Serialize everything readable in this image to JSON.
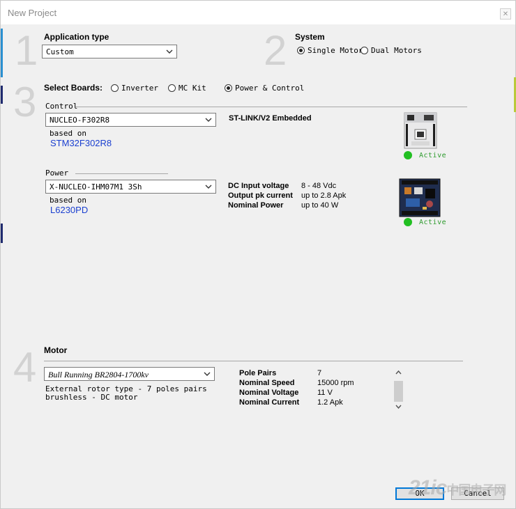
{
  "window": {
    "title": "New Project",
    "close_icon": "close-icon"
  },
  "sections": {
    "n1": "1",
    "n2": "2",
    "n3": "3",
    "n4": "4"
  },
  "application_type": {
    "label": "Application type",
    "value": "Custom"
  },
  "system": {
    "label": "System",
    "options": [
      "Single Motor",
      "Dual Motors"
    ],
    "selected": "Single Motor"
  },
  "boards": {
    "label": "Select Boards:",
    "options": [
      "Inverter",
      "MC Kit",
      "Power & Control"
    ],
    "selected": "Power & Control",
    "control": {
      "label": "Control",
      "value": "NUCLEO-F302R8",
      "based_on_label": "based on",
      "mcu": "STM32F302R8",
      "feature": "ST-LINK/V2 Embedded",
      "status": "Active"
    },
    "power": {
      "label": "Power",
      "value": "X-NUCLEO-IHM07M1 3Sh",
      "based_on_label": "based on",
      "driver": "L6230PD",
      "specs": [
        {
          "key": "DC Input voltage",
          "value": "8 - 48 Vdc"
        },
        {
          "key": "Output pk current",
          "value": "up to 2.8 Apk"
        },
        {
          "key": "Nominal Power",
          "value": "up to 40 W"
        }
      ],
      "status": "Active"
    }
  },
  "motor": {
    "label": "Motor",
    "value": "Bull Running BR2804-1700kv",
    "description_line1": "External rotor type - 7 poles pairs",
    "description_line2": "brushless - DC motor",
    "specs": [
      {
        "key": "Pole Pairs",
        "value": "7"
      },
      {
        "key": "Nominal Speed",
        "value": "15000 rpm"
      },
      {
        "key": "Nominal Voltage",
        "value": "11 V"
      },
      {
        "key": "Nominal Current",
        "value": "1.2 Apk"
      }
    ]
  },
  "buttons": {
    "ok": "OK",
    "cancel": "Cancel"
  },
  "watermark": {
    "text": "21ic",
    "sub": "中国电子网"
  },
  "colors": {
    "active_green": "#22bf22",
    "link_blue": "#1a3fd0",
    "accent": "#0078d7"
  }
}
